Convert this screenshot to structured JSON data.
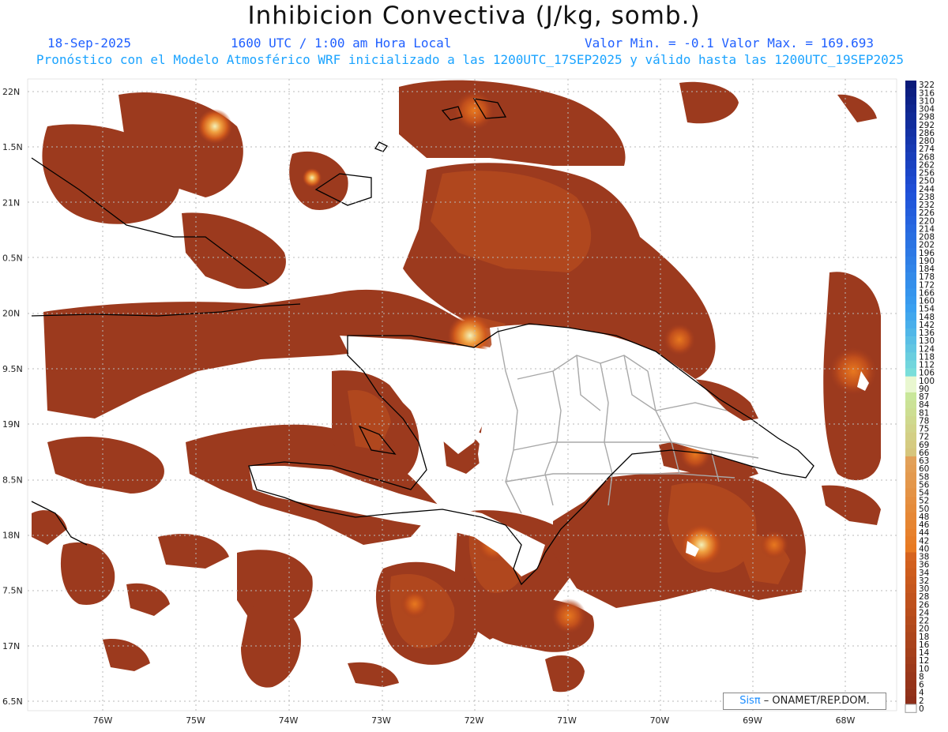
{
  "header": {
    "title": "Inhibicion Convectiva (J/kg, somb.)",
    "date": "18-Sep-2025",
    "time": "1600 UTC / 1:00 am Hora Local",
    "min_max": "Valor Min. = -0.1  Valor Max. = 169.693",
    "description": "Pronóstico con el Modelo Atmosférico WRF inicializado a las 1200UTC_17SEP2025 y válido hasta las  1200UTC_19SEP2025"
  },
  "map": {
    "lon_labels": [
      "76W",
      "75W",
      "74W",
      "73W",
      "72W",
      "71W",
      "70W",
      "69W",
      "68W"
    ],
    "lat_labels": [
      "22N",
      "1.5N",
      "21N",
      "0.5N",
      "20N",
      "9.5N",
      "19N",
      "8.5N",
      "18N",
      "7.5N",
      "17N",
      "6.5N"
    ],
    "fill_colors": {
      "low": "#8e2f1c",
      "mid": "#b8451c",
      "high": "#e06a1e",
      "peak": "#f5c86a",
      "max": "#f2f0b8"
    },
    "land_color": "#ffffff",
    "border_color": "#a8a8a8",
    "coast_color": "#000000"
  },
  "colorbar": {
    "labels": [
      "322",
      "316",
      "310",
      "304",
      "298",
      "292",
      "286",
      "280",
      "274",
      "268",
      "262",
      "256",
      "250",
      "244",
      "238",
      "232",
      "226",
      "220",
      "214",
      "208",
      "202",
      "196",
      "190",
      "184",
      "178",
      "172",
      "166",
      "160",
      "154",
      "148",
      "142",
      "136",
      "130",
      "124",
      "118",
      "112",
      "106",
      "100",
      "90",
      "87",
      "84",
      "81",
      "78",
      "75",
      "72",
      "69",
      "66",
      "63",
      "60",
      "58",
      "56",
      "54",
      "52",
      "50",
      "48",
      "46",
      "44",
      "42",
      "40",
      "38",
      "36",
      "34",
      "32",
      "30",
      "28",
      "26",
      "24",
      "22",
      "20",
      "18",
      "16",
      "14",
      "12",
      "10",
      "8",
      "6",
      "4",
      "2",
      "0"
    ]
  },
  "credit": {
    "logo": "Sisπ",
    "org": " – ONAMET/REP.DOM."
  }
}
